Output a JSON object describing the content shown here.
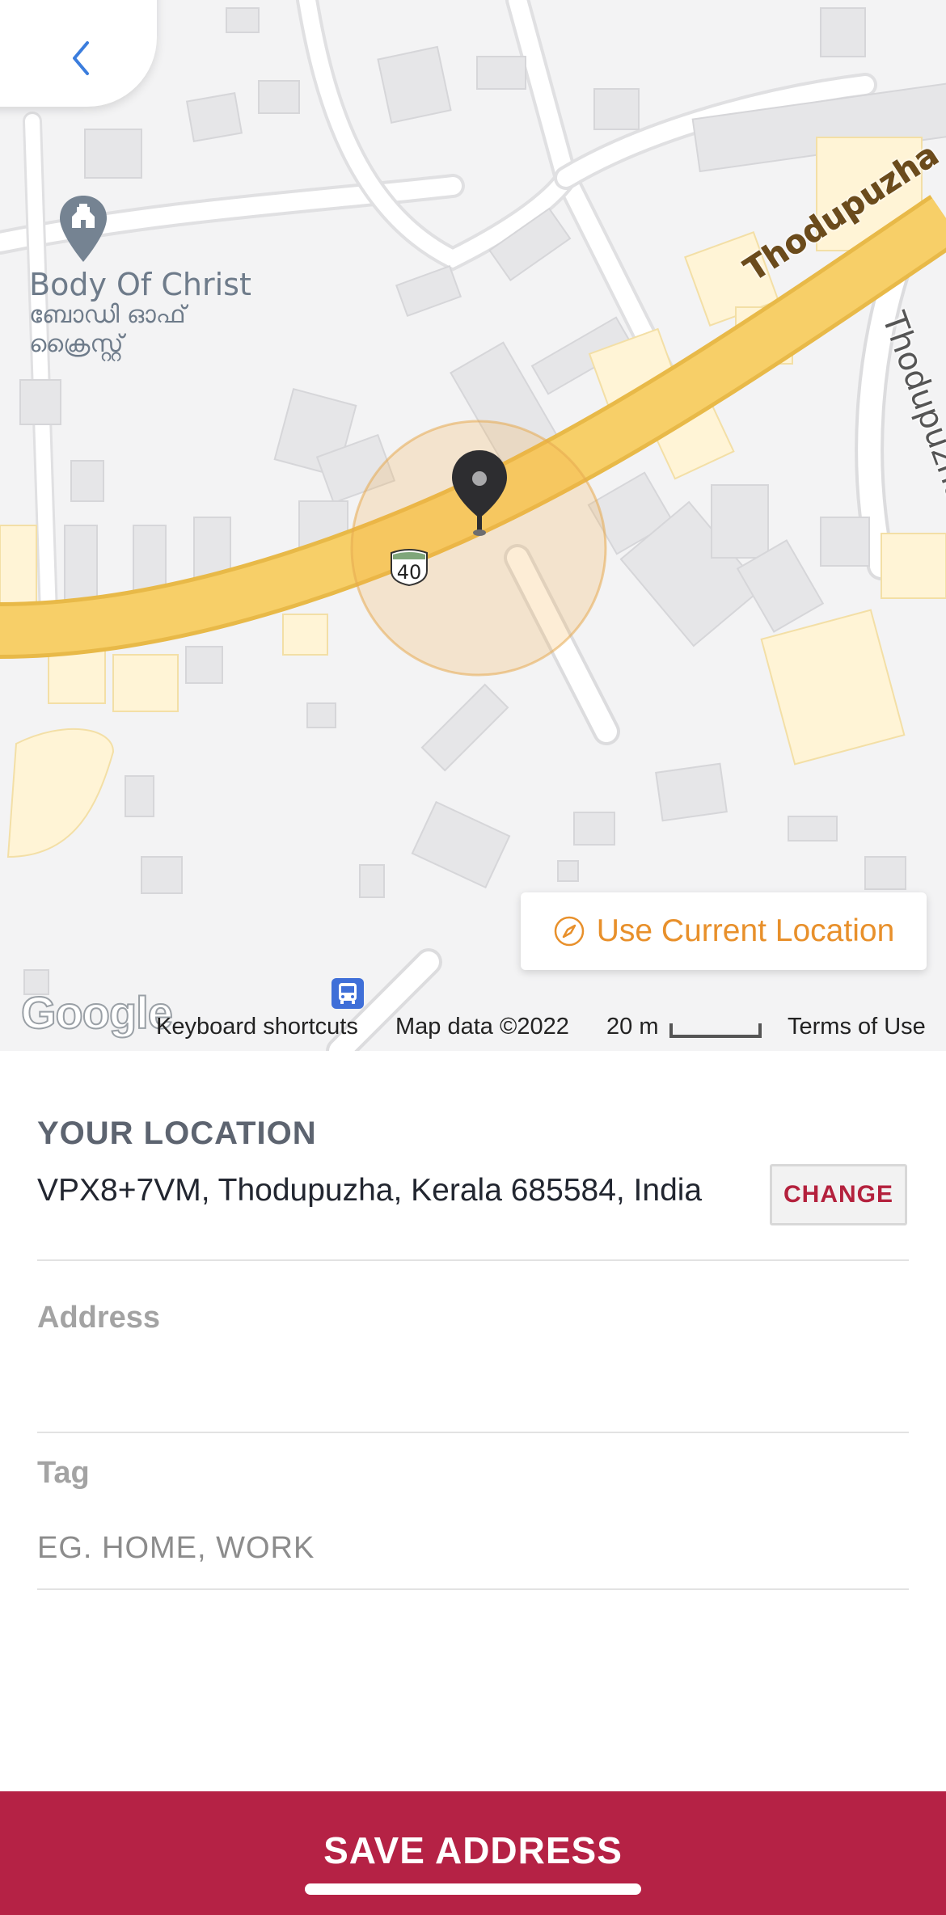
{
  "map": {
    "poi_name": "Body Of Christ",
    "poi_name_local": "ബോഡി ഓഫ്",
    "poi_name_local_2": "ക്രൈസ്റ്റ്",
    "road_main": "Thodupuzha",
    "road_bypass": "Thodupuzha Bypass",
    "route_shield": "40",
    "use_current_location": "Use Current Location",
    "google_logo": "Google",
    "keyboard_shortcuts": "Keyboard shortcuts",
    "map_data": "Map data ©2022",
    "scale": "20 m",
    "terms": "Terms of Use"
  },
  "location": {
    "label": "YOUR LOCATION",
    "value": "VPX8+7VM, Thodupuzha, Kerala 685584, India",
    "change_label": "CHANGE"
  },
  "address": {
    "label": "Address",
    "value": "",
    "placeholder": ""
  },
  "tag": {
    "label": "Tag",
    "value": "",
    "placeholder": "EG. HOME, WORK"
  },
  "footer": {
    "save_label": "SAVE ADDRESS"
  },
  "colors": {
    "accent": "#b52245",
    "map_action": "#e8902b",
    "back_arrow": "#3b7ddd"
  }
}
